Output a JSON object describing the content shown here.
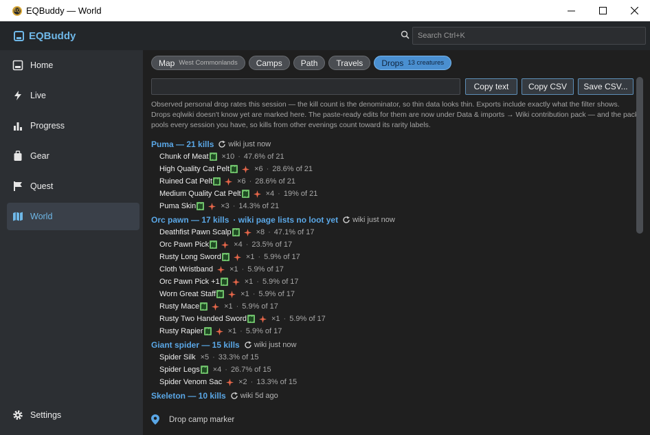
{
  "window": {
    "title": "EQBuddy — World",
    "icon_text": "EQ"
  },
  "brand": {
    "name": "EQBuddy"
  },
  "search": {
    "placeholder": "Search  Ctrl+K"
  },
  "sidebar": {
    "items": [
      {
        "label": "Home",
        "icon": "home-icon"
      },
      {
        "label": "Live",
        "icon": "bolt-icon"
      },
      {
        "label": "Progress",
        "icon": "bar-chart-icon"
      },
      {
        "label": "Gear",
        "icon": "bag-icon"
      },
      {
        "label": "Quest",
        "icon": "flag-icon"
      },
      {
        "label": "World",
        "icon": "map-icon",
        "active": true
      }
    ],
    "settings_label": "Settings"
  },
  "tabs": [
    {
      "label": "Map",
      "sub": "West Commonlands"
    },
    {
      "label": "Camps",
      "sub": ""
    },
    {
      "label": "Path",
      "sub": ""
    },
    {
      "label": "Travels",
      "sub": ""
    },
    {
      "label": "Drops",
      "sub": "13 creatures",
      "active": true
    }
  ],
  "toolbar": {
    "copy_text": "Copy text",
    "copy_csv": "Copy CSV",
    "save_csv": "Save CSV..."
  },
  "description": "Observed personal drop rates this session — the kill count is the denominator, so thin data looks thin. Exports include exactly what the filter shows. Drops eqlwiki doesn't know yet are marked here. The paste-ready edits for them are now under Data & imports → Wiki contribution pack — and the pack pools every session you have, so kills from other evenings count toward its rarity labels.",
  "groups": [
    {
      "name": "Puma — 21 kills",
      "warning": "",
      "wiki": "wiki just now",
      "drops": [
        {
          "name": "Chunk of Meat",
          "map": true,
          "star": false,
          "count": "×10",
          "rate": "47.6% of 21"
        },
        {
          "name": "High Quality Cat Pelt",
          "map": true,
          "star": true,
          "count": "×6",
          "rate": "28.6% of 21"
        },
        {
          "name": "Ruined Cat Pelt",
          "map": true,
          "star": true,
          "count": "×6",
          "rate": "28.6% of 21"
        },
        {
          "name": "Medium Quality Cat Pelt",
          "map": true,
          "star": true,
          "count": "×4",
          "rate": "19% of 21"
        },
        {
          "name": "Puma Skin",
          "map": true,
          "star": true,
          "count": "×3",
          "rate": "14.3% of 21"
        }
      ]
    },
    {
      "name": "Orc pawn — 17 kills",
      "warning": "·  wiki page lists no loot yet",
      "wiki": "wiki just now",
      "drops": [
        {
          "name": "Deathfist Pawn Scalp",
          "map": true,
          "star": true,
          "count": "×8",
          "rate": "47.1% of 17"
        },
        {
          "name": "Orc Pawn Pick",
          "map": true,
          "star": true,
          "count": "×4",
          "rate": "23.5% of 17"
        },
        {
          "name": "Rusty Long Sword",
          "map": true,
          "star": true,
          "count": "×1",
          "rate": "5.9% of 17"
        },
        {
          "name": "Cloth Wristband",
          "map": false,
          "star": true,
          "count": "×1",
          "rate": "5.9% of 17"
        },
        {
          "name": "Orc Pawn Pick +1",
          "map": true,
          "star": true,
          "count": "×1",
          "rate": "5.9% of 17"
        },
        {
          "name": "Worn Great Staff",
          "map": true,
          "star": true,
          "count": "×1",
          "rate": "5.9% of 17"
        },
        {
          "name": "Rusty Mace",
          "map": true,
          "star": true,
          "count": "×1",
          "rate": "5.9% of 17"
        },
        {
          "name": "Rusty Two Handed Sword",
          "map": true,
          "star": true,
          "count": "×1",
          "rate": "5.9% of 17"
        },
        {
          "name": "Rusty Rapier",
          "map": true,
          "star": true,
          "count": "×1",
          "rate": "5.9% of 17"
        }
      ]
    },
    {
      "name": "Giant spider — 15 kills",
      "warning": "",
      "wiki": "wiki just now",
      "drops": [
        {
          "name": "Spider Silk",
          "map": false,
          "star": false,
          "count": "×5",
          "rate": "33.3% of 15"
        },
        {
          "name": "Spider Legs",
          "map": true,
          "star": false,
          "count": "×4",
          "rate": "26.7% of 15"
        },
        {
          "name": "Spider Venom Sac",
          "map": false,
          "star": true,
          "count": "×2",
          "rate": "13.3% of 15"
        }
      ]
    },
    {
      "name": "Skeleton — 10 kills",
      "warning": "",
      "wiki": "wiki 5d ago",
      "drops": []
    }
  ],
  "camp_marker": {
    "label": "Drop camp marker"
  },
  "colors": {
    "accent": "#5aa7e6",
    "star": "#e8674a",
    "map_badge": "#6fc06a"
  }
}
